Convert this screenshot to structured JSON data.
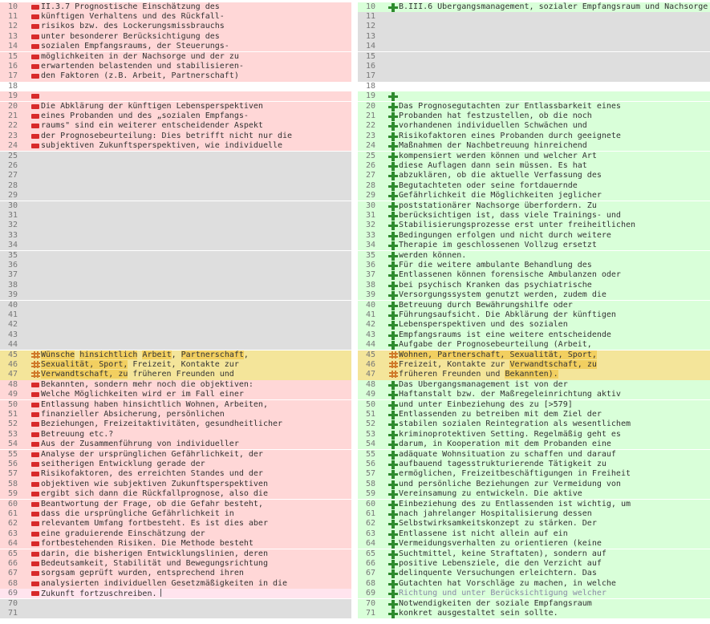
{
  "left": {
    "rows": [
      {
        "n": "10",
        "type": "del",
        "text": "II.3.7 Prognostische Einschätzung des"
      },
      {
        "n": "11",
        "type": "del",
        "text": "künftigen Verhaltens und des Rückfall-"
      },
      {
        "n": "12",
        "type": "del",
        "text": "risikos bzw. des Lockerungsmissbrauchs"
      },
      {
        "n": "13",
        "type": "del",
        "text": "unter besonderer Berücksichtigung des"
      },
      {
        "n": "14",
        "type": "del",
        "text": "sozialen Empfangsraums, der Steuerungs-"
      },
      {
        "n": "15",
        "type": "del",
        "text": "möglichkeiten in der Nachsorge und der zu"
      },
      {
        "n": "16",
        "type": "del",
        "text": "erwartenden belastenden und stabilisieren-"
      },
      {
        "n": "17",
        "type": "del",
        "text": "den Faktoren (z.B. Arbeit, Partnerschaft)"
      },
      {
        "n": "18",
        "type": "white",
        "text": ""
      },
      {
        "n": "19",
        "type": "del",
        "text": ""
      },
      {
        "n": "20",
        "type": "del",
        "text": "Die Abklärung der künftigen Lebensperspektiven"
      },
      {
        "n": "21",
        "type": "del",
        "text": "eines Probanden und des „sozialen Empfangs-"
      },
      {
        "n": "22",
        "type": "del",
        "text": "raums\" sind ein weiterer entscheidender Aspekt"
      },
      {
        "n": "23",
        "type": "del",
        "text": "der Prognosebeurteilung: Dies betrifft nicht nur die"
      },
      {
        "n": "24",
        "type": "del",
        "text": "subjektiven Zukunftsperspektiven, wie individuelle"
      },
      {
        "n": "25",
        "type": "empty",
        "text": ""
      },
      {
        "n": "26",
        "type": "empty",
        "text": ""
      },
      {
        "n": "27",
        "type": "empty",
        "text": ""
      },
      {
        "n": "28",
        "type": "empty",
        "text": ""
      },
      {
        "n": "29",
        "type": "empty",
        "text": ""
      },
      {
        "n": "30",
        "type": "empty",
        "text": ""
      },
      {
        "n": "31",
        "type": "empty",
        "text": ""
      },
      {
        "n": "32",
        "type": "empty",
        "text": ""
      },
      {
        "n": "33",
        "type": "empty",
        "text": ""
      },
      {
        "n": "34",
        "type": "empty",
        "text": ""
      },
      {
        "n": "35",
        "type": "empty",
        "text": ""
      },
      {
        "n": "36",
        "type": "empty",
        "text": ""
      },
      {
        "n": "37",
        "type": "empty",
        "text": ""
      },
      {
        "n": "38",
        "type": "empty",
        "text": ""
      },
      {
        "n": "39",
        "type": "empty",
        "text": ""
      },
      {
        "n": "40",
        "type": "empty",
        "text": ""
      },
      {
        "n": "41",
        "type": "empty",
        "text": ""
      },
      {
        "n": "42",
        "type": "empty",
        "text": ""
      },
      {
        "n": "43",
        "type": "empty",
        "text": ""
      },
      {
        "n": "44",
        "type": "empty",
        "text": ""
      },
      {
        "n": "45",
        "type": "mod",
        "segs": [
          {
            "t": "Wünsche",
            "h": 1
          },
          {
            "t": " "
          },
          {
            "t": "hinsichtlich",
            "h": 1
          },
          {
            "t": " "
          },
          {
            "t": "Arbeit",
            "h": 1
          },
          {
            "t": ", "
          },
          {
            "t": "Partnerschaft",
            "h": 1
          },
          {
            "t": ","
          }
        ]
      },
      {
        "n": "46",
        "type": "mod",
        "segs": [
          {
            "t": "Sexualität, Sport,",
            "h": 1
          },
          {
            "t": " Freizeit, Kontakte zur"
          }
        ]
      },
      {
        "n": "47",
        "type": "mod",
        "segs": [
          {
            "t": "Verwandtschaft, zu",
            "h": 1
          },
          {
            "t": " früheren Freunden und"
          }
        ]
      },
      {
        "n": "48",
        "type": "del",
        "text": "Bekannten, sondern mehr noch die objektiven:"
      },
      {
        "n": "49",
        "type": "del",
        "text": "Welche Möglichkeiten wird er im Fall einer"
      },
      {
        "n": "50",
        "type": "del",
        "text": "Entlassung haben hinsichtlich Wohnen, Arbeiten,"
      },
      {
        "n": "51",
        "type": "del",
        "text": "finanzieller Absicherung, persönlichen"
      },
      {
        "n": "52",
        "type": "del",
        "text": "Beziehungen, Freizeitaktivitäten, gesundheitlicher"
      },
      {
        "n": "53",
        "type": "del",
        "text": "Betreuung etc.?"
      },
      {
        "n": "54",
        "type": "del",
        "text": "Aus der Zusammenführung von individueller"
      },
      {
        "n": "55",
        "type": "del",
        "text": "Analyse der ursprünglichen Gefährlichkeit, der"
      },
      {
        "n": "56",
        "type": "del",
        "text": "seitherigen Entwicklung gerade der"
      },
      {
        "n": "57",
        "type": "del",
        "text": "Risikofaktoren, des erreichten Standes und der"
      },
      {
        "n": "58",
        "type": "del",
        "text": "objektiven wie subjektiven Zukunftsperspektiven"
      },
      {
        "n": "59",
        "type": "del",
        "text": "ergibt sich dann die Rückfallprognose, also die"
      },
      {
        "n": "60",
        "type": "del",
        "text": "Beantwortung der Frage, ob die Gefahr besteht,"
      },
      {
        "n": "61",
        "type": "del",
        "text": "dass die ursprüngliche Gefährlichkeit in"
      },
      {
        "n": "62",
        "type": "del",
        "text": "relevantem Umfang fortbesteht. Es ist dies aber"
      },
      {
        "n": "63",
        "type": "del",
        "text": "eine graduierende Einschätzung der"
      },
      {
        "n": "64",
        "type": "del",
        "text": "fortbestehenden Risiken. Die Methode besteht"
      },
      {
        "n": "65",
        "type": "del",
        "text": "darin, die bisherigen Entwicklungslinien, deren"
      },
      {
        "n": "66",
        "type": "del",
        "text": "Bedeutsamkeit, Stabilität und Bewegungsrichtung"
      },
      {
        "n": "67",
        "type": "del",
        "text": "sorgsam geprüft wurden, entsprechend ihren"
      },
      {
        "n": "68",
        "type": "del",
        "text": "analysierten individuellen Gesetzmäßigkeiten in die"
      },
      {
        "n": "69",
        "type": "cursor",
        "text": "Zukunft fortzuschreiben."
      },
      {
        "n": "70",
        "type": "empty",
        "text": ""
      },
      {
        "n": "71",
        "type": "empty",
        "text": ""
      }
    ]
  },
  "right": {
    "rows": [
      {
        "n": "10",
        "type": "add",
        "text": "B.III.6 Übergangsmanagement, sozialer Empfangsraum und Nachsorge"
      },
      {
        "n": "11",
        "type": "empty",
        "text": ""
      },
      {
        "n": "12",
        "type": "empty",
        "text": ""
      },
      {
        "n": "13",
        "type": "empty",
        "text": ""
      },
      {
        "n": "14",
        "type": "empty",
        "text": ""
      },
      {
        "n": "15",
        "type": "empty",
        "text": ""
      },
      {
        "n": "16",
        "type": "empty",
        "text": ""
      },
      {
        "n": "17",
        "type": "empty",
        "text": ""
      },
      {
        "n": "18",
        "type": "white",
        "text": ""
      },
      {
        "n": "19",
        "type": "add",
        "text": ""
      },
      {
        "n": "20",
        "type": "add",
        "text": "Das Prognosegutachten zur Entlassbarkeit eines"
      },
      {
        "n": "21",
        "type": "add",
        "text": "Probanden hat festzustellen, ob die noch"
      },
      {
        "n": "22",
        "type": "add",
        "text": "vorhandenen individuellen Schwächen und"
      },
      {
        "n": "23",
        "type": "add",
        "text": "Risikofaktoren eines Probanden durch geeignete"
      },
      {
        "n": "24",
        "type": "add",
        "text": "Maßnahmen der Nachbetreuung hinreichend"
      },
      {
        "n": "25",
        "type": "add",
        "text": "kompensiert werden können und welcher Art"
      },
      {
        "n": "26",
        "type": "add",
        "text": "diese Auflagen dann sein müssen. Es hat"
      },
      {
        "n": "27",
        "type": "add",
        "text": "abzuklären, ob die aktuelle Verfassung des"
      },
      {
        "n": "28",
        "type": "add",
        "text": "Begutachteten oder seine fortdauernde"
      },
      {
        "n": "29",
        "type": "add",
        "text": "Gefährlichkeit die Möglichkeiten jeglicher"
      },
      {
        "n": "30",
        "type": "add",
        "text": "poststationärer Nachsorge überfordern. Zu"
      },
      {
        "n": "31",
        "type": "add",
        "text": "berücksichtigen ist, dass viele Trainings- und"
      },
      {
        "n": "32",
        "type": "add",
        "text": "Stabilisierungsprozesse erst unter freiheitlichen"
      },
      {
        "n": "33",
        "type": "add",
        "text": "Bedingungen erfolgen und nicht durch weitere"
      },
      {
        "n": "34",
        "type": "add",
        "text": "Therapie im geschlossenen Vollzug ersetzt"
      },
      {
        "n": "35",
        "type": "add",
        "text": "werden können."
      },
      {
        "n": "36",
        "type": "add",
        "text": "Für die weitere ambulante Behandlung des"
      },
      {
        "n": "37",
        "type": "add",
        "text": "Entlassenen können forensische Ambulanzen oder"
      },
      {
        "n": "38",
        "type": "add",
        "text": "bei psychisch Kranken das psychiatrische"
      },
      {
        "n": "39",
        "type": "add",
        "text": "Versorgungssystem genutzt werden, zudem die"
      },
      {
        "n": "40",
        "type": "add",
        "text": "Betreuung durch Bewährungshilfe oder"
      },
      {
        "n": "41",
        "type": "add",
        "text": "Führungsaufsicht. Die Abklärung der künftigen"
      },
      {
        "n": "42",
        "type": "add",
        "text": "Lebensperspektiven und des sozialen"
      },
      {
        "n": "43",
        "type": "add",
        "text": "Empfangsraums ist eine weitere entscheidende"
      },
      {
        "n": "44",
        "type": "add",
        "text": "Aufgabe der Prognosebeurteilung (Arbeit,"
      },
      {
        "n": "45",
        "type": "mod",
        "segs": [
          {
            "t": "Wohnen, Partnerschaft, Sexualität, Sport,",
            "h": 1
          }
        ]
      },
      {
        "n": "46",
        "type": "mod",
        "segs": [
          {
            "t": "Freizeit, Kontakte zur "
          },
          {
            "t": "Verwandtschaft, zu",
            "h": 1
          }
        ]
      },
      {
        "n": "47",
        "type": "mod",
        "segs": [
          {
            "t": "früheren Freunden und "
          },
          {
            "t": "Bekannten).",
            "h": 1
          }
        ]
      },
      {
        "n": "48",
        "type": "add",
        "text": "Das Übergangsmanagement ist von der"
      },
      {
        "n": "49",
        "type": "add",
        "text": "Haftanstalt bzw. der Maßregeleinrichtung aktiv"
      },
      {
        "n": "50",
        "type": "add",
        "text": "und unter Einbeziehung des zu [>579]"
      },
      {
        "n": "51",
        "type": "add",
        "text": "Entlassenden zu betreiben mit dem Ziel der"
      },
      {
        "n": "52",
        "type": "add",
        "text": "stabilen sozialen Reintegration als wesentlichem"
      },
      {
        "n": "53",
        "type": "add",
        "text": "kriminoprotektiven Setting. Regelmäßig geht es"
      },
      {
        "n": "54",
        "type": "add",
        "text": "darum, in Kooperation mit dem Probanden eine"
      },
      {
        "n": "55",
        "type": "add",
        "text": "adäquate Wohnsituation zu schaffen und darauf"
      },
      {
        "n": "56",
        "type": "add",
        "text": "aufbauend tagesstrukturierende Tätigkeit zu"
      },
      {
        "n": "57",
        "type": "add",
        "text": "ermöglichen, Freizeitbeschäftigungen in Freiheit"
      },
      {
        "n": "58",
        "type": "add",
        "text": "und persönliche Beziehungen zur Vermeidung von"
      },
      {
        "n": "59",
        "type": "add",
        "text": "Vereinsamung zu entwickeln. Die aktive"
      },
      {
        "n": "60",
        "type": "add",
        "text": "Einbeziehung des zu Entlassenden ist wichtig, um"
      },
      {
        "n": "61",
        "type": "add",
        "text": "nach jahrelanger Hospitalisierung dessen"
      },
      {
        "n": "62",
        "type": "add",
        "text": "Selbstwirksamkeitskonzept zu stärken. Der"
      },
      {
        "n": "63",
        "type": "add",
        "text": "Entlassene ist nicht allein auf ein"
      },
      {
        "n": "64",
        "type": "add",
        "text": "Vermeidungsverhalten zu orientieren (keine"
      },
      {
        "n": "65",
        "type": "add",
        "text": "Suchtmittel, keine Straftaten), sondern auf"
      },
      {
        "n": "66",
        "type": "add",
        "text": "positive Lebensziele, die den Verzicht auf"
      },
      {
        "n": "67",
        "type": "add",
        "text": "delinquente Versuchungen erleichtern. Das"
      },
      {
        "n": "68",
        "type": "add",
        "text": "Gutachten hat Vorschläge zu machen, in welche"
      },
      {
        "n": "69",
        "type": "addfaded",
        "text": "Richtung und unter Berücksichtigung welcher"
      },
      {
        "n": "70",
        "type": "add",
        "text": "Notwendigkeiten der soziale Empfangsraum"
      },
      {
        "n": "71",
        "type": "add",
        "text": "konkret ausgestaltet sein sollte."
      }
    ]
  }
}
